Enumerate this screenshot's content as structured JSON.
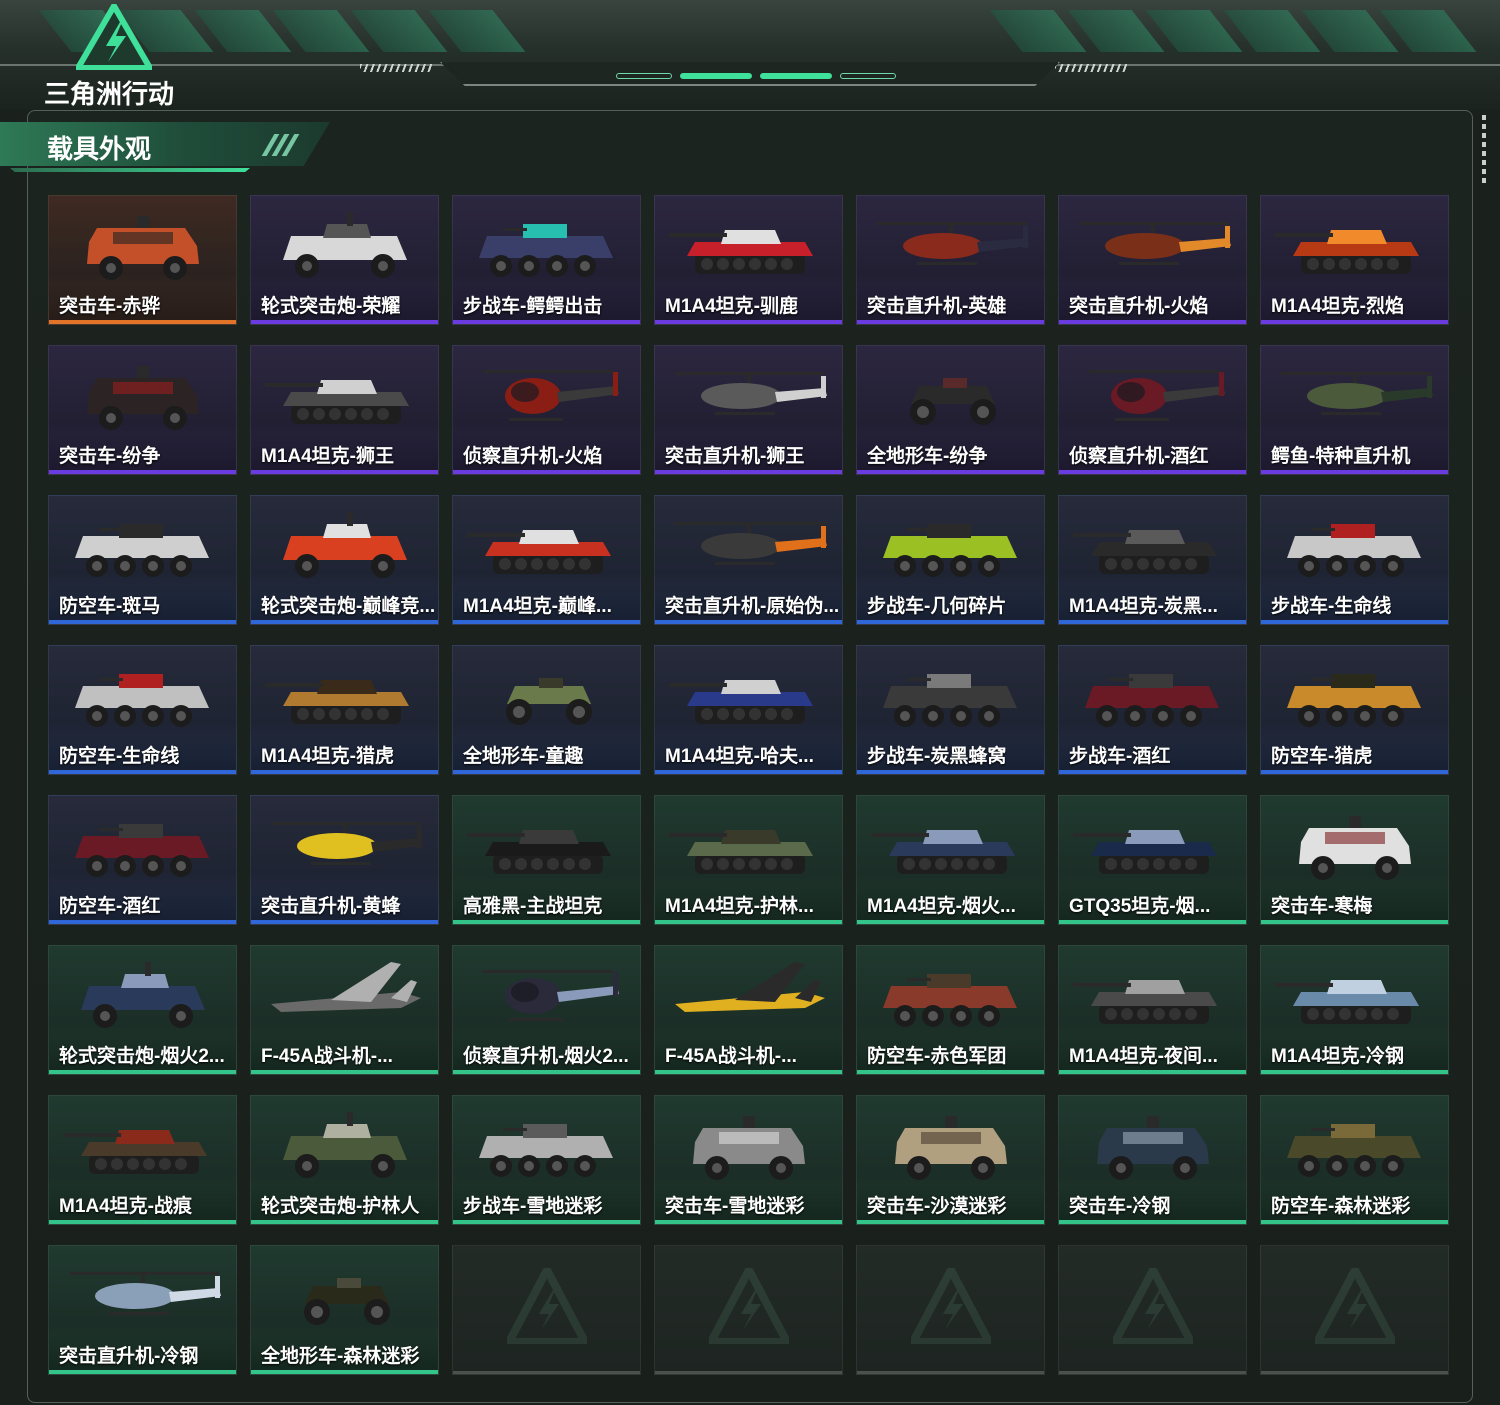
{
  "app": {
    "logo_text": "三角洲行动",
    "accent": "#3fe09a"
  },
  "section": {
    "title": "载具外观"
  },
  "rarity_colors": {
    "orange": "#e2742a",
    "purple": "#6a3ce0",
    "blue": "#2f67d8",
    "green": "#33c48a"
  },
  "items": [
    {
      "label": "突击车-赤骅",
      "rarity": "orange",
      "icon": "assault-vehicle-icon"
    },
    {
      "label": "轮式突击炮-荣耀",
      "rarity": "purple",
      "icon": "wheeled-assault-gun-icon"
    },
    {
      "label": "步战车-鳄鳄出击",
      "rarity": "purple",
      "icon": "ifv-icon"
    },
    {
      "label": "M1A4坦克-驯鹿",
      "rarity": "purple",
      "icon": "tank-icon"
    },
    {
      "label": "突击直升机-英雄",
      "rarity": "purple",
      "icon": "attack-helicopter-icon"
    },
    {
      "label": "突击直升机-火焰",
      "rarity": "purple",
      "icon": "attack-helicopter-icon"
    },
    {
      "label": "M1A4坦克-烈焰",
      "rarity": "purple",
      "icon": "tank-icon"
    },
    {
      "label": "突击车-纷争",
      "rarity": "purple",
      "icon": "assault-vehicle-icon"
    },
    {
      "label": "M1A4坦克-狮王",
      "rarity": "purple",
      "icon": "tank-icon"
    },
    {
      "label": "侦察直升机-火焰",
      "rarity": "purple",
      "icon": "scout-helicopter-icon"
    },
    {
      "label": "突击直升机-狮王",
      "rarity": "purple",
      "icon": "attack-helicopter-icon"
    },
    {
      "label": "全地形车-纷争",
      "rarity": "purple",
      "icon": "atv-icon"
    },
    {
      "label": "侦察直升机-酒红",
      "rarity": "purple",
      "icon": "scout-helicopter-icon"
    },
    {
      "label": "鳄鱼-特种直升机",
      "rarity": "purple",
      "icon": "attack-helicopter-icon"
    },
    {
      "label": "防空车-斑马",
      "rarity": "blue",
      "icon": "ifv-icon"
    },
    {
      "label": "轮式突击炮-巅峰竞...",
      "rarity": "blue",
      "icon": "wheeled-assault-gun-icon"
    },
    {
      "label": "M1A4坦克-巅峰...",
      "rarity": "blue",
      "icon": "tank-icon"
    },
    {
      "label": "突击直升机-原始伪...",
      "rarity": "blue",
      "icon": "attack-helicopter-icon"
    },
    {
      "label": "步战车-几何碎片",
      "rarity": "blue",
      "icon": "ifv-icon"
    },
    {
      "label": "M1A4坦克-炭黑...",
      "rarity": "blue",
      "icon": "tank-icon"
    },
    {
      "label": "步战车-生命线",
      "rarity": "blue",
      "icon": "ifv-icon"
    },
    {
      "label": "防空车-生命线",
      "rarity": "blue",
      "icon": "ifv-icon"
    },
    {
      "label": "M1A4坦克-猎虎",
      "rarity": "blue",
      "icon": "tank-icon"
    },
    {
      "label": "全地形车-童趣",
      "rarity": "blue",
      "icon": "atv-icon"
    },
    {
      "label": "M1A4坦克-哈夫...",
      "rarity": "blue",
      "icon": "tank-icon"
    },
    {
      "label": "步战车-炭黑蜂窝",
      "rarity": "blue",
      "icon": "ifv-icon"
    },
    {
      "label": "步战车-酒红",
      "rarity": "blue",
      "icon": "ifv-icon"
    },
    {
      "label": "防空车-猎虎",
      "rarity": "blue",
      "icon": "ifv-icon"
    },
    {
      "label": "防空车-酒红",
      "rarity": "blue",
      "icon": "ifv-icon"
    },
    {
      "label": "突击直升机-黄蜂",
      "rarity": "blue",
      "icon": "attack-helicopter-icon"
    },
    {
      "label": "高雅黑-主战坦克",
      "rarity": "green",
      "icon": "tank-icon"
    },
    {
      "label": "M1A4坦克-护林...",
      "rarity": "green",
      "icon": "tank-icon"
    },
    {
      "label": "M1A4坦克-烟火...",
      "rarity": "green",
      "icon": "tank-icon"
    },
    {
      "label": "GTQ35坦克-烟...",
      "rarity": "green",
      "icon": "tank-icon"
    },
    {
      "label": "突击车-寒梅",
      "rarity": "green",
      "icon": "assault-vehicle-icon"
    },
    {
      "label": "轮式突击炮-烟火2...",
      "rarity": "green",
      "icon": "wheeled-assault-gun-icon"
    },
    {
      "label": "F-45A战斗机-...",
      "rarity": "green",
      "icon": "fighter-jet-icon"
    },
    {
      "label": "侦察直升机-烟火2...",
      "rarity": "green",
      "icon": "scout-helicopter-icon"
    },
    {
      "label": "F-45A战斗机-...",
      "rarity": "green",
      "icon": "fighter-jet-icon"
    },
    {
      "label": "防空车-赤色军团",
      "rarity": "green",
      "icon": "ifv-icon"
    },
    {
      "label": "M1A4坦克-夜间...",
      "rarity": "green",
      "icon": "tank-icon"
    },
    {
      "label": "M1A4坦克-冷钢",
      "rarity": "green",
      "icon": "tank-icon"
    },
    {
      "label": "M1A4坦克-战痕",
      "rarity": "green",
      "icon": "tank-icon"
    },
    {
      "label": "轮式突击炮-护林人",
      "rarity": "green",
      "icon": "wheeled-assault-gun-icon"
    },
    {
      "label": "步战车-雪地迷彩",
      "rarity": "green",
      "icon": "ifv-icon"
    },
    {
      "label": "突击车-雪地迷彩",
      "rarity": "green",
      "icon": "assault-vehicle-icon"
    },
    {
      "label": "突击车-沙漠迷彩",
      "rarity": "green",
      "icon": "assault-vehicle-icon"
    },
    {
      "label": "突击车-冷钢",
      "rarity": "green",
      "icon": "assault-vehicle-icon"
    },
    {
      "label": "防空车-森林迷彩",
      "rarity": "green",
      "icon": "ifv-icon"
    },
    {
      "label": "突击直升机-冷钢",
      "rarity": "green",
      "icon": "attack-helicopter-icon"
    },
    {
      "label": "全地形车-森林迷彩",
      "rarity": "green",
      "icon": "atv-icon"
    }
  ],
  "empty_slots": 5
}
